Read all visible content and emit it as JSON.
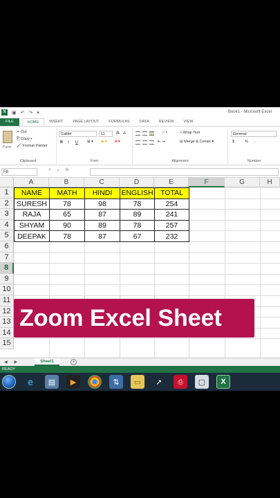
{
  "window": {
    "title": "Book1 - Microsoft Excel"
  },
  "ribbon_tabs": [
    "FILE",
    "HOME",
    "INSERT",
    "PAGE LAYOUT",
    "FORMULAS",
    "DATA",
    "REVIEW",
    "VIEW"
  ],
  "clipboard": {
    "paste": "Paste",
    "cut": "Cut",
    "copy": "Copy",
    "format_painter": "Format Painter",
    "label": "Clipboard"
  },
  "font": {
    "name": "Calibri",
    "size": "11",
    "bold": "B",
    "italic": "I",
    "underline": "U",
    "grow": "A",
    "shrink": "A",
    "label": "Font"
  },
  "alignment": {
    "wrap_text": "Wrap Text",
    "merge_center": "Merge & Center",
    "label": "Alignment"
  },
  "number": {
    "format": "General",
    "currency": "$",
    "percent": "%",
    "comma": ",",
    "label": "Number"
  },
  "formula_bar": {
    "name_box": "F8",
    "cancel": "×",
    "enter": "✓",
    "fx": "fx",
    "value": ""
  },
  "columns": [
    "A",
    "B",
    "C",
    "D",
    "E",
    "F",
    "G",
    "H"
  ],
  "rows": [
    "1",
    "2",
    "3",
    "4",
    "5",
    "6",
    "7",
    "8",
    "9",
    "10",
    "11",
    "12",
    "13",
    "14",
    "15"
  ],
  "table": {
    "headers": [
      "NAME",
      "MATH",
      "HINDI",
      "ENGLISH",
      "TOTAL"
    ],
    "rows": [
      [
        "SURESH",
        "78",
        "98",
        "78",
        "254"
      ],
      [
        "RAJA",
        "65",
        "87",
        "89",
        "241"
      ],
      [
        "SHYAM",
        "90",
        "89",
        "78",
        "257"
      ],
      [
        "DEEPAK",
        "78",
        "87",
        "67",
        "232"
      ]
    ]
  },
  "selected_cell": "F8",
  "overlay": {
    "text": "Zoom Excel Sheet",
    "color": "#b3124f"
  },
  "sheet": {
    "nav_prev": "◀",
    "nav_next": "▶",
    "tab": "Sheet1",
    "add": "+"
  },
  "status": "READY",
  "taskbar_icons": [
    "start-orb-icon",
    "ie-icon",
    "files-icon",
    "media-player-icon",
    "chrome-icon",
    "network-icon",
    "folder-icon",
    "cursor-tool-icon",
    "pdf-icon",
    "screen-icon",
    "excel-icon"
  ],
  "colors": {
    "excel_green": "#217346",
    "header_fill": "#ffff00"
  }
}
